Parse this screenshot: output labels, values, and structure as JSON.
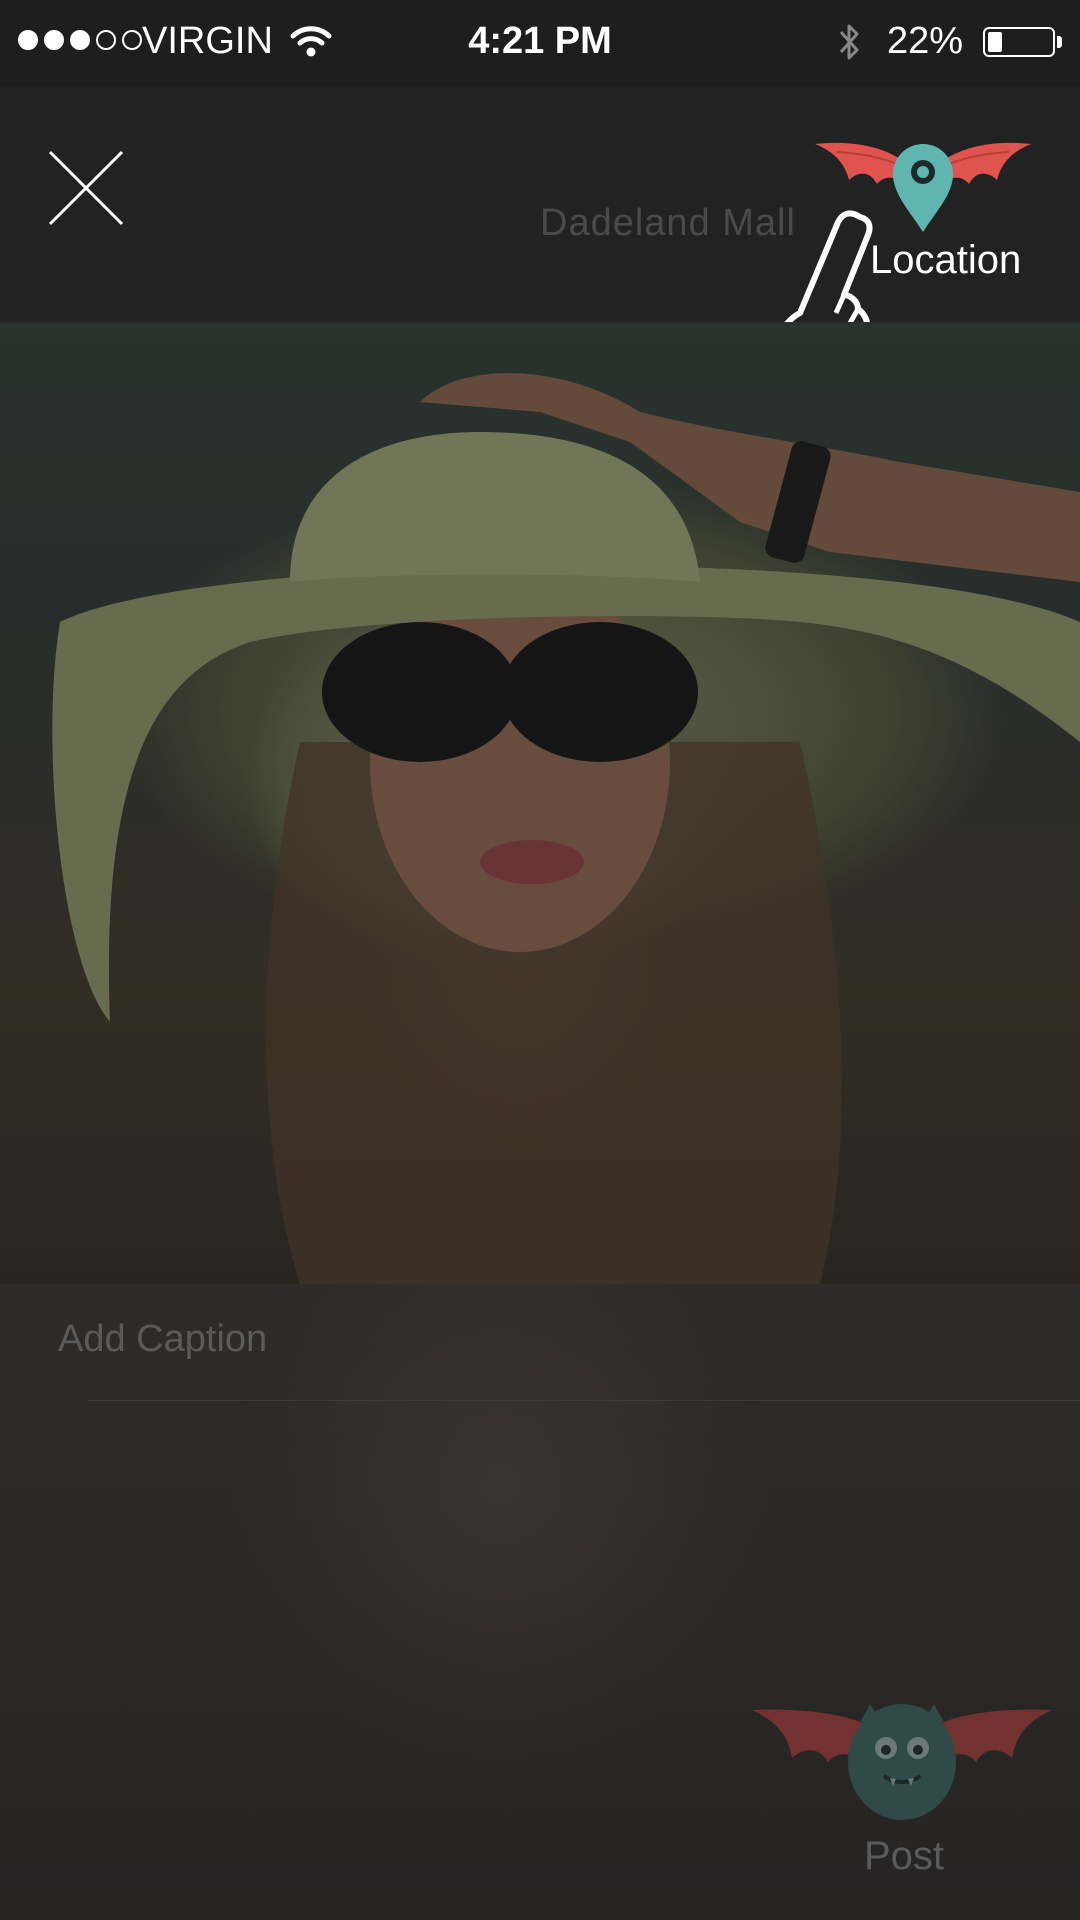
{
  "status_bar": {
    "carrier": "VIRGIN",
    "time": "4:21 PM",
    "battery_percent": "22%",
    "signal_bars_filled": 3,
    "signal_bars_total": 5,
    "battery_level": 0.22
  },
  "header": {
    "location_name": "Dadeland Mall",
    "location_label": "Location",
    "close_icon": "close-icon",
    "location_icon": "location-pin-bat-icon"
  },
  "caption": {
    "placeholder": "Add Caption"
  },
  "post": {
    "label": "Post",
    "icon": "bat-mascot-icon"
  },
  "colors": {
    "accent_red": "#e0544f",
    "accent_teal": "#5fb6b0",
    "overlay_dark": "#222222"
  }
}
